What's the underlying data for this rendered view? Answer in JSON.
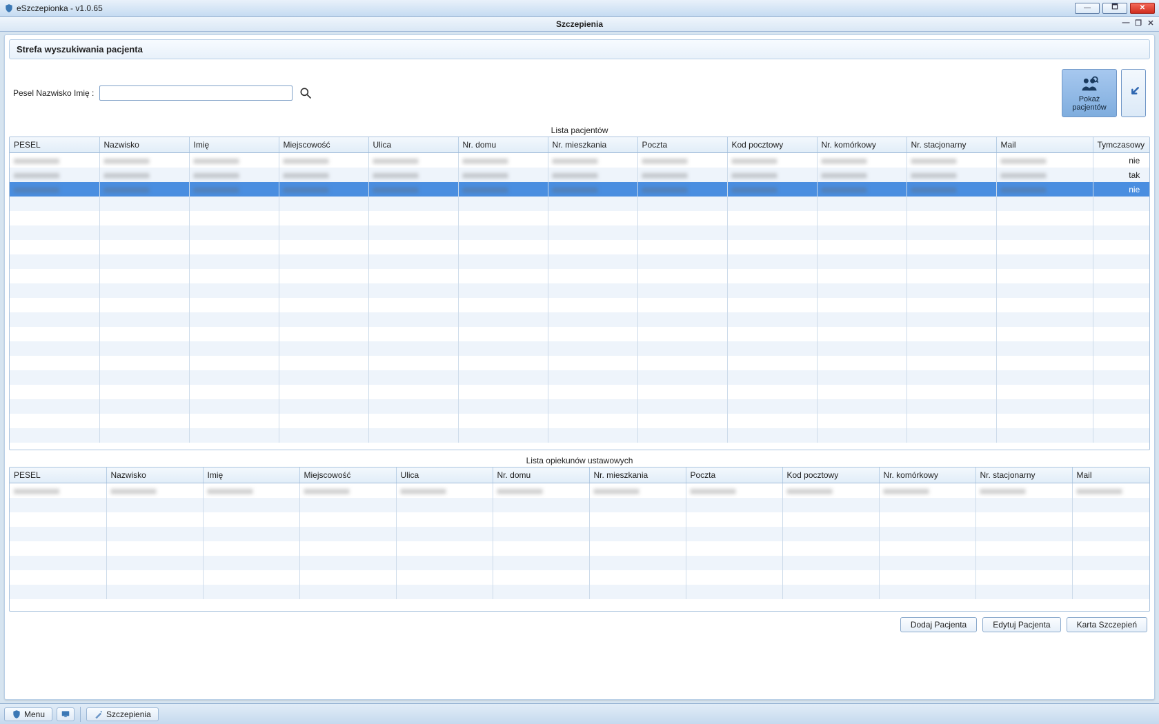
{
  "window": {
    "title": "eSzczepionka - v1.0.65"
  },
  "subwindow": {
    "title": "Szczepienia"
  },
  "section": {
    "title": "Strefa wyszukiwania pacjenta"
  },
  "search": {
    "label": "Pesel Nazwisko Imię :",
    "value": ""
  },
  "show_patients_btn": {
    "line1": "Pokaż",
    "line2": "pacjentów"
  },
  "patients": {
    "title": "Lista pacjentów",
    "columns": [
      "PESEL",
      "Nazwisko",
      "Imię",
      "Miejscowość",
      "Ulica",
      "Nr. domu",
      "Nr. mieszkania",
      "Poczta",
      "Kod pocztowy",
      "Nr. komórkowy",
      "Nr. stacjonarny",
      "Mail",
      "Tymczasowy"
    ],
    "rows": [
      {
        "tymczasowy": "nie",
        "selected": false
      },
      {
        "tymczasowy": "tak",
        "selected": false
      },
      {
        "tymczasowy": "nie",
        "selected": true
      }
    ],
    "empty_rows": 17
  },
  "guardians": {
    "title": "Lista opiekunów ustawowych",
    "columns": [
      "PESEL",
      "Nazwisko",
      "Imię",
      "Miejscowość",
      "Ulica",
      "Nr. domu",
      "Nr. mieszkania",
      "Poczta",
      "Kod pocztowy",
      "Nr. komórkowy",
      "Nr. stacjonarny",
      "Mail"
    ],
    "rows": [
      {}
    ],
    "empty_rows": 7
  },
  "buttons": {
    "add": "Dodaj Pacjenta",
    "edit": "Edytuj Pacjenta",
    "card": "Karta Szczepień"
  },
  "taskbar": {
    "menu": "Menu",
    "tab": "Szczepienia"
  },
  "colwidths_p": [
    130,
    130,
    130,
    130,
    130,
    130,
    130,
    130,
    130,
    130,
    130,
    140,
    120
  ],
  "colwidths_g": [
    140,
    140,
    140,
    140,
    140,
    140,
    140,
    140,
    140,
    140,
    140,
    150
  ]
}
